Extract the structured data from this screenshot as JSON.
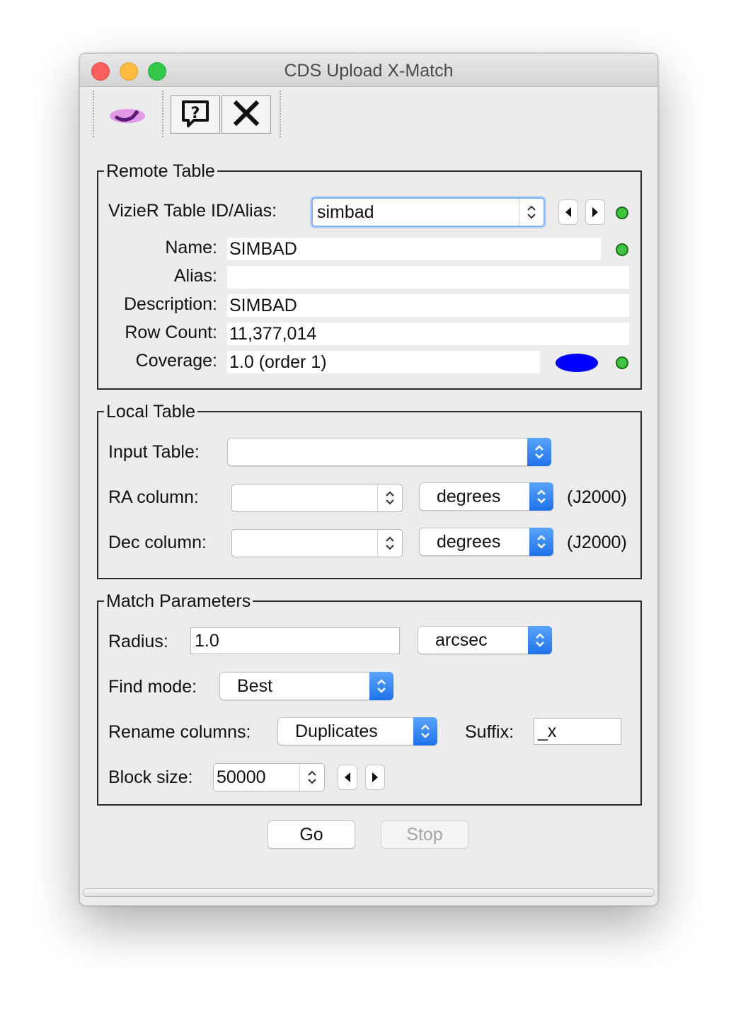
{
  "window": {
    "title": "CDS Upload X-Match"
  },
  "toolbar": {
    "logo_icon": "cds-logo-icon",
    "help_icon": "help-icon",
    "close_icon": "close-icon"
  },
  "remote": {
    "legend": "Remote Table",
    "id_label": "VizieR Table ID/Alias:",
    "id_value": "simbad",
    "name_label": "Name:",
    "name_value": "SIMBAD",
    "alias_label": "Alias:",
    "alias_value": "",
    "desc_label": "Description:",
    "desc_value": "SIMBAD",
    "rows_label": "Row Count:",
    "rows_value": "11,377,014",
    "cov_label": "Coverage:",
    "cov_value": "1.0 (order 1)",
    "coverage_color": "#0000ff",
    "status_color": "#3fc43f"
  },
  "local": {
    "legend": "Local Table",
    "input_label": "Input Table:",
    "input_value": "",
    "ra_label": "RA column:",
    "ra_value": "",
    "ra_unit": "degrees",
    "ra_epoch": "(J2000)",
    "dec_label": "Dec column:",
    "dec_value": "",
    "dec_unit": "degrees",
    "dec_epoch": "(J2000)"
  },
  "match": {
    "legend": "Match Parameters",
    "radius_label": "Radius:",
    "radius_value": "1.0",
    "radius_unit": "arcsec",
    "find_label": "Find mode:",
    "find_value": "Best",
    "rename_label": "Rename columns:",
    "rename_value": "Duplicates",
    "suffix_label": "Suffix:",
    "suffix_value": "_x",
    "block_label": "Block size:",
    "block_value": "50000"
  },
  "actions": {
    "go": "Go",
    "stop": "Stop"
  },
  "colors": {
    "combo_accent": "#2f7ef0",
    "focus": "#7fb0ef"
  }
}
